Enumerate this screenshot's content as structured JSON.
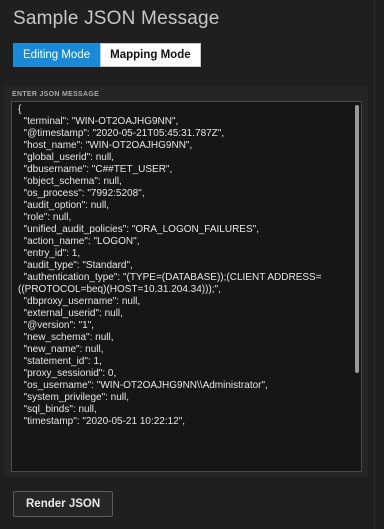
{
  "title": "Sample JSON Message",
  "modes": {
    "editing": "Editing Mode",
    "mapping": "Mapping Mode"
  },
  "section_label": "ENTER JSON MESSAGE",
  "json_lines": [
    "{",
    "  \"terminal\": \"WIN-OT2OAJHG9NN\",",
    "  \"@timestamp\": \"2020-05-21T05:45:31.787Z\",",
    "  \"host_name\": \"WIN-OT2OAJHG9NN\",",
    "  \"global_userid\": null,",
    "  \"dbusername\": \"C##TET_USER\",",
    "  \"object_schema\": null,",
    "  \"os_process\": \"7992:5208\",",
    "  \"audit_option\": null,",
    "  \"role\": null,",
    "  \"unified_audit_policies\": \"ORA_LOGON_FAILURES\",",
    "  \"action_name\": \"LOGON\",",
    "  \"entry_id\": 1,",
    "  \"audit_type\": \"Standard\",",
    "  \"authentication_type\": \"(TYPE=(DATABASE));(CLIENT ADDRESS=",
    "((PROTOCOL=beq)(HOST=10.31.204.34)));\",",
    "  \"dbproxy_username\": null,",
    "  \"external_userid\": null,",
    "  \"@version\": \"1\",",
    "  \"new_schema\": null,",
    "  \"new_name\": null,",
    "  \"statement_id\": 1,",
    "  \"proxy_sessionid\": 0,",
    "  \"os_username\": \"WIN-OT2OAJHG9NN\\\\Administrator\",",
    "  \"system_privilege\": null,",
    "  \"sql_binds\": null,",
    "  \"timestamp\": \"2020-05-21 10:22:12\","
  ],
  "render_button": "Render JSON"
}
